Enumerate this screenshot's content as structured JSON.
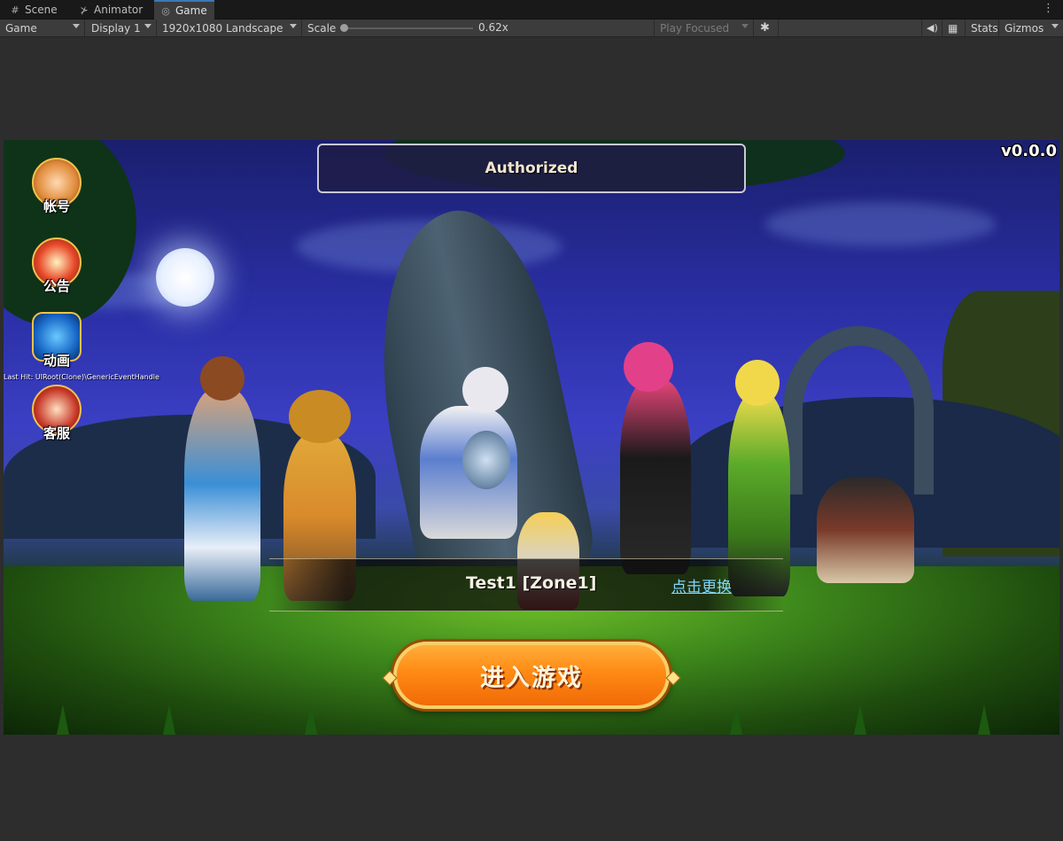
{
  "tabs": [
    {
      "label": "Scene",
      "icon": "grid-icon"
    },
    {
      "label": "Animator",
      "icon": "animator-icon"
    },
    {
      "label": "Game",
      "icon": "gamepad-icon",
      "active": true
    }
  ],
  "toolbar": {
    "view_mode": "Game",
    "display": "Display 1",
    "resolution": "1920x1080 Landscape",
    "scale_label": "Scale",
    "scale_value": "0.62x",
    "play_mode": "Play Focused",
    "stats": "Stats",
    "gizmos": "Gizmos"
  },
  "game": {
    "status_title": "Authorized",
    "version": "v0.0.0",
    "side_menu": [
      {
        "label": "帐号",
        "icon": "account-avatar-icon"
      },
      {
        "label": "公告",
        "icon": "megaphone-icon"
      },
      {
        "label": "动画",
        "icon": "video-play-icon"
      },
      {
        "label": "客服",
        "icon": "support-avatar-icon"
      }
    ],
    "last_hit": "Last Hit: UIRoot(Clone)\\GenericEventHandle",
    "server_name": "Test1 [Zone1]",
    "switch_server": "点击更换",
    "enter_game": "进入游戏"
  },
  "colors": {
    "editor_bg": "#282828",
    "tab_active_accent": "#3a79bb",
    "button_orange": "#ff8a14",
    "link_blue": "#7fd7ff"
  }
}
